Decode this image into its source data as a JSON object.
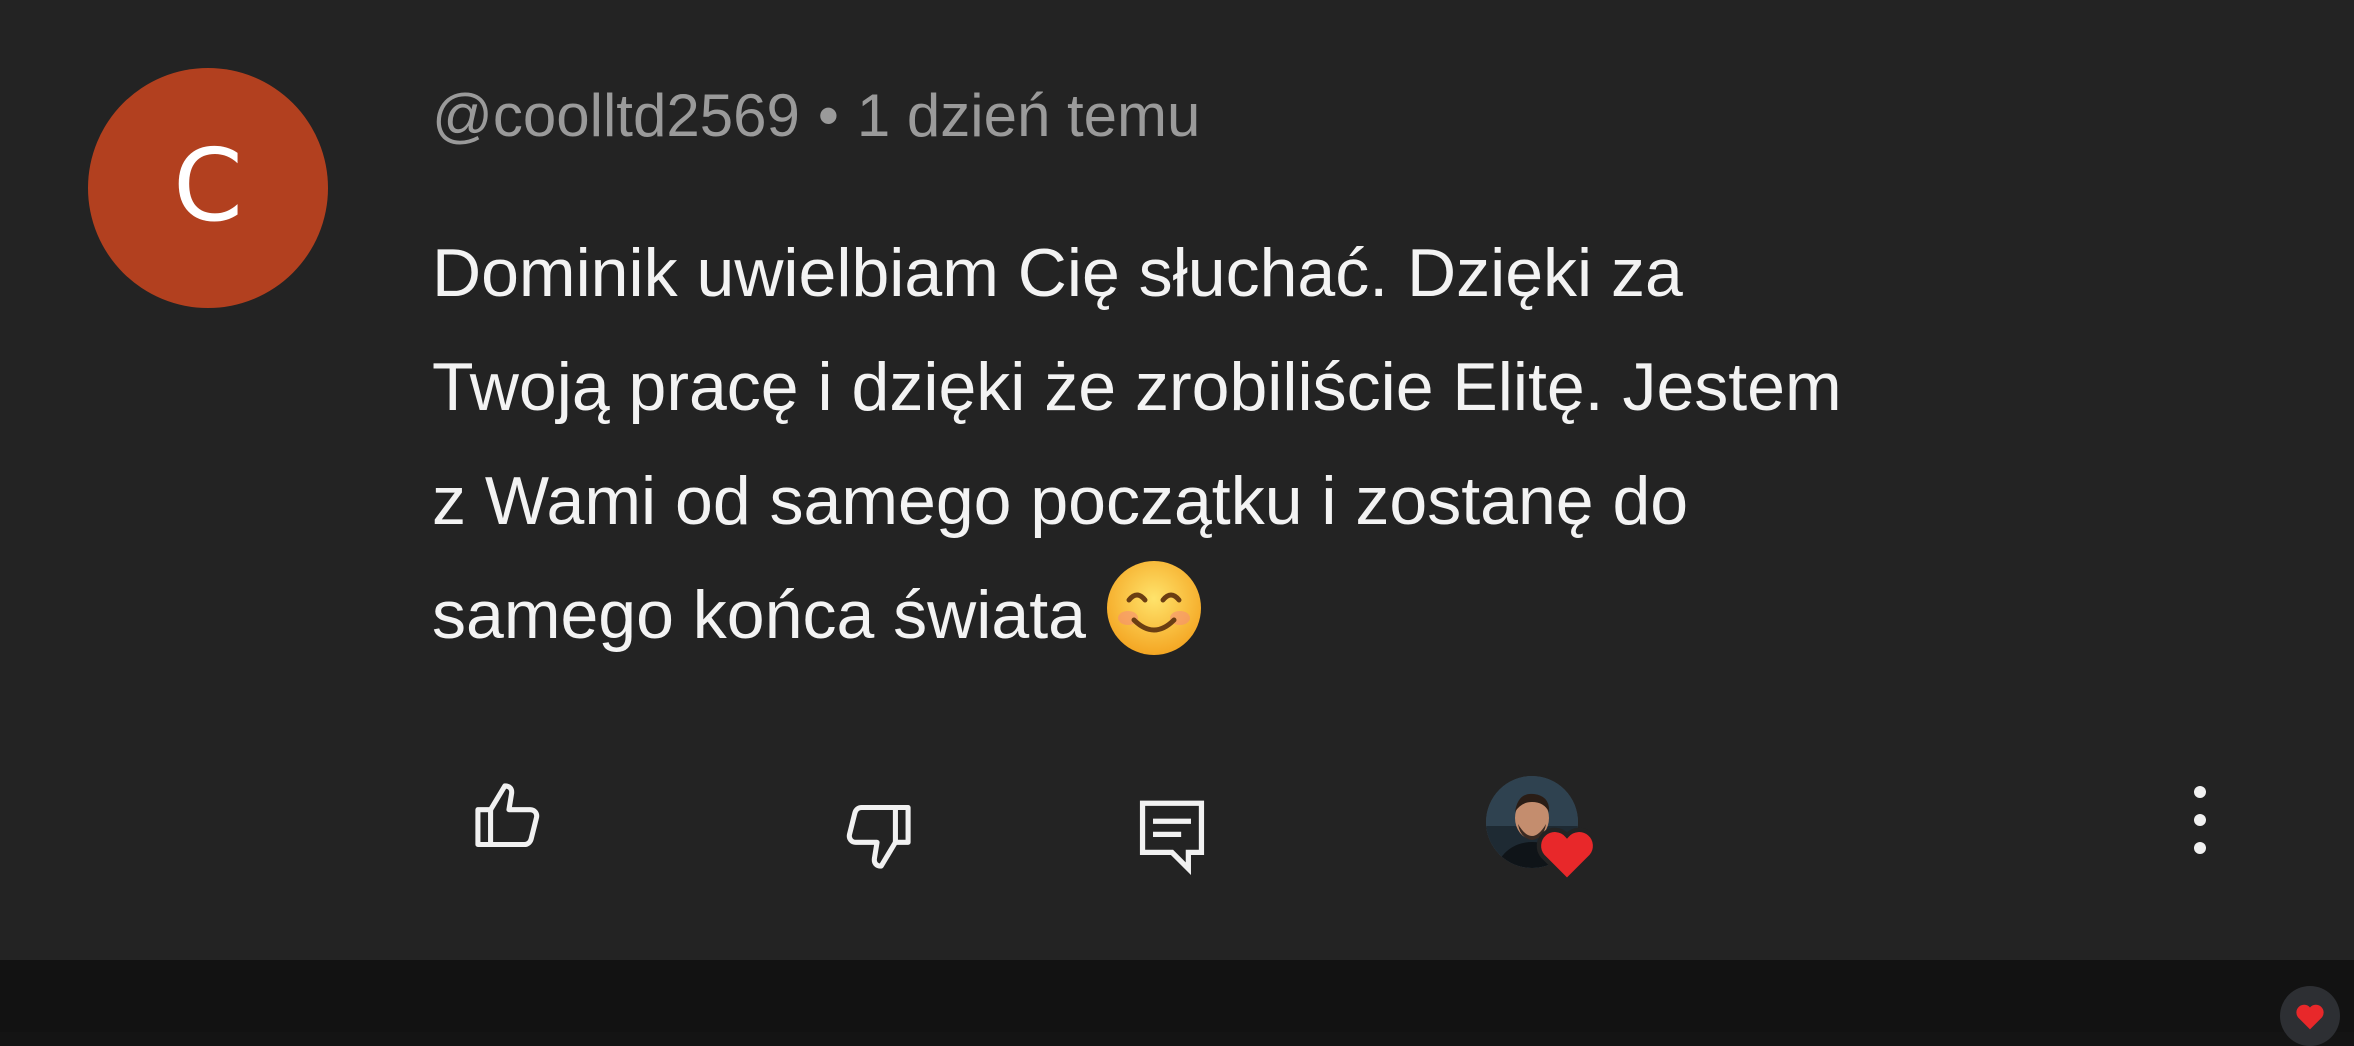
{
  "comment": {
    "avatar_letter": "C",
    "author": "@coolltd2569",
    "separator": "•",
    "time": "1 dzień temu",
    "lines": [
      "Dominik uwielbiam Cię słuchać. Dzięki za",
      "Twoją pracę i dzięki że zrobiliście Elitę. Jestem",
      "z Wami od samego początku i zostanę do",
      "samego końca świata"
    ],
    "emoji": "smiling-face-icon"
  },
  "colors": {
    "avatar_bg": "#b2401f",
    "card_bg": "#232323",
    "heart": "#e8282a"
  }
}
